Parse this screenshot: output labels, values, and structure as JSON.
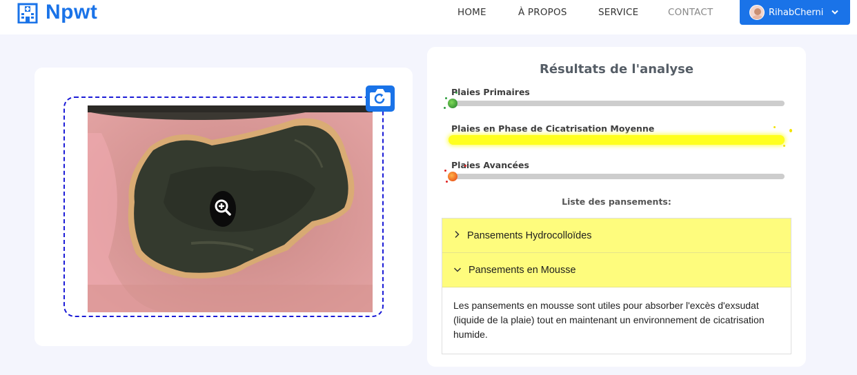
{
  "brand": {
    "name": "Npwt",
    "icon": "hospital-icon"
  },
  "nav": {
    "items": [
      {
        "label": "HOME",
        "active": false
      },
      {
        "label": "À PROPOS",
        "active": false
      },
      {
        "label": "SERVICE",
        "active": false
      },
      {
        "label": "CONTACT",
        "active": false,
        "muted": true
      }
    ],
    "user": {
      "name": "RihabCherni",
      "icon": "chevron-down-icon"
    }
  },
  "upload": {
    "camera_icon": "camera-rotate-icon",
    "zoom_icon": "zoom-in-icon"
  },
  "results": {
    "title": "Résultats de l'analyse",
    "categories": [
      {
        "label": "Plaies Primaires",
        "level": 0.02,
        "color": "#2e9e3e"
      },
      {
        "label": "Plaies en Phase de Cicatrisation Moyenne",
        "level": 1.0,
        "color": "#ffff1e"
      },
      {
        "label": "Plaies Avancées",
        "level": 0.02,
        "color": "#f05a14"
      }
    ],
    "list_title": "Liste des pansements:",
    "dressings": [
      {
        "name": "Pansements Hydrocolloïdes",
        "expanded": false
      },
      {
        "name": "Pansements en Mousse",
        "expanded": true,
        "description": "Les pansements en mousse sont utiles pour absorber l'excès d'exsudat (liquide de la plaie) tout en maintenant un environnement de cicatrisation humide."
      }
    ],
    "accent_color": "#fefc7d"
  },
  "colors": {
    "brand": "#1a73e8",
    "page_bg": "#f4f5fd",
    "dash": "#1a1ad6"
  }
}
